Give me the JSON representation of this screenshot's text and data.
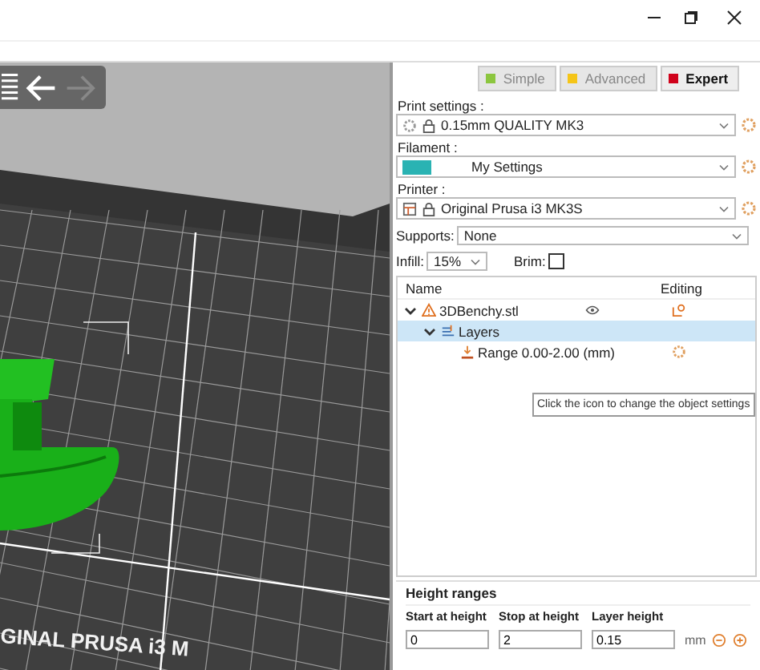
{
  "viewport": {
    "bed_label": "GINAL PRUSA i3 M"
  },
  "mode_tabs": [
    {
      "label": "Simple",
      "selected": false,
      "color": "#8cc63f"
    },
    {
      "label": "Advanced",
      "selected": false,
      "color": "#f5c518"
    },
    {
      "label": "Expert",
      "selected": true,
      "color": "#d0021b"
    }
  ],
  "print_settings": {
    "label": "Print settings :",
    "value": "0.15mm QUALITY MK3"
  },
  "filament": {
    "label": "Filament :",
    "value": "My Settings",
    "color": "#2ab3b3"
  },
  "printer": {
    "label": "Printer :",
    "value": "Original Prusa i3 MK3S"
  },
  "supports": {
    "label": "Supports:",
    "value": "None"
  },
  "infill": {
    "label": "Infill:",
    "value": "15%"
  },
  "brim": {
    "label": "Brim:",
    "checked": false
  },
  "object_list": {
    "columns": [
      "Name",
      "Editing"
    ],
    "rows": [
      {
        "kind": "object",
        "name": "3DBenchy.stl",
        "expanded": true,
        "selected": false,
        "children": [
          {
            "kind": "layers",
            "name": "Layers",
            "expanded": true,
            "selected": true,
            "children": [
              {
                "kind": "range",
                "name": "Range 0.00-2.00 (mm)",
                "selected": false
              }
            ]
          }
        ]
      }
    ]
  },
  "tooltip": "Click the icon to change the object settings",
  "height_ranges": {
    "title": "Height ranges",
    "columns": [
      "Start at height",
      "Stop at height",
      "Layer height"
    ],
    "values": [
      "0",
      "2",
      "0.15"
    ],
    "unit": "mm"
  }
}
